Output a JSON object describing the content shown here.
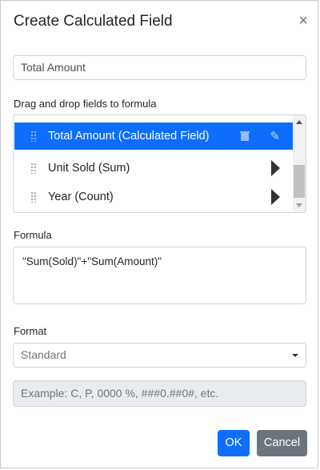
{
  "dialog": {
    "title": "Create Calculated Field",
    "close_symbol": "×"
  },
  "name_input": {
    "value": "Total Amount"
  },
  "fields": {
    "label": "Drag and drop fields to formula",
    "items": [
      {
        "label": "Total Amount (Calculated Field)",
        "selected": true,
        "icons": [
          "trash-icon",
          "pencil-icon"
        ]
      },
      {
        "label": "Unit Sold (Sum)",
        "selected": false,
        "icons": [
          "expand-arrow-icon"
        ]
      },
      {
        "label": "Year (Count)",
        "selected": false,
        "icons": [
          "expand-arrow-icon"
        ]
      }
    ]
  },
  "formula": {
    "label": "Formula",
    "value": "\"Sum(Sold)\"+\"Sum(Amount)\""
  },
  "format": {
    "label": "Format",
    "selected": "Standard"
  },
  "custom_format": {
    "placeholder": "Example: C, P, 0000 %, ###0.##0#, etc."
  },
  "buttons": {
    "ok": "OK",
    "cancel": "Cancel"
  },
  "colors": {
    "selected_row": "#0d6efd",
    "ok_button": "#0d6efd",
    "cancel_button": "#6c757d"
  }
}
